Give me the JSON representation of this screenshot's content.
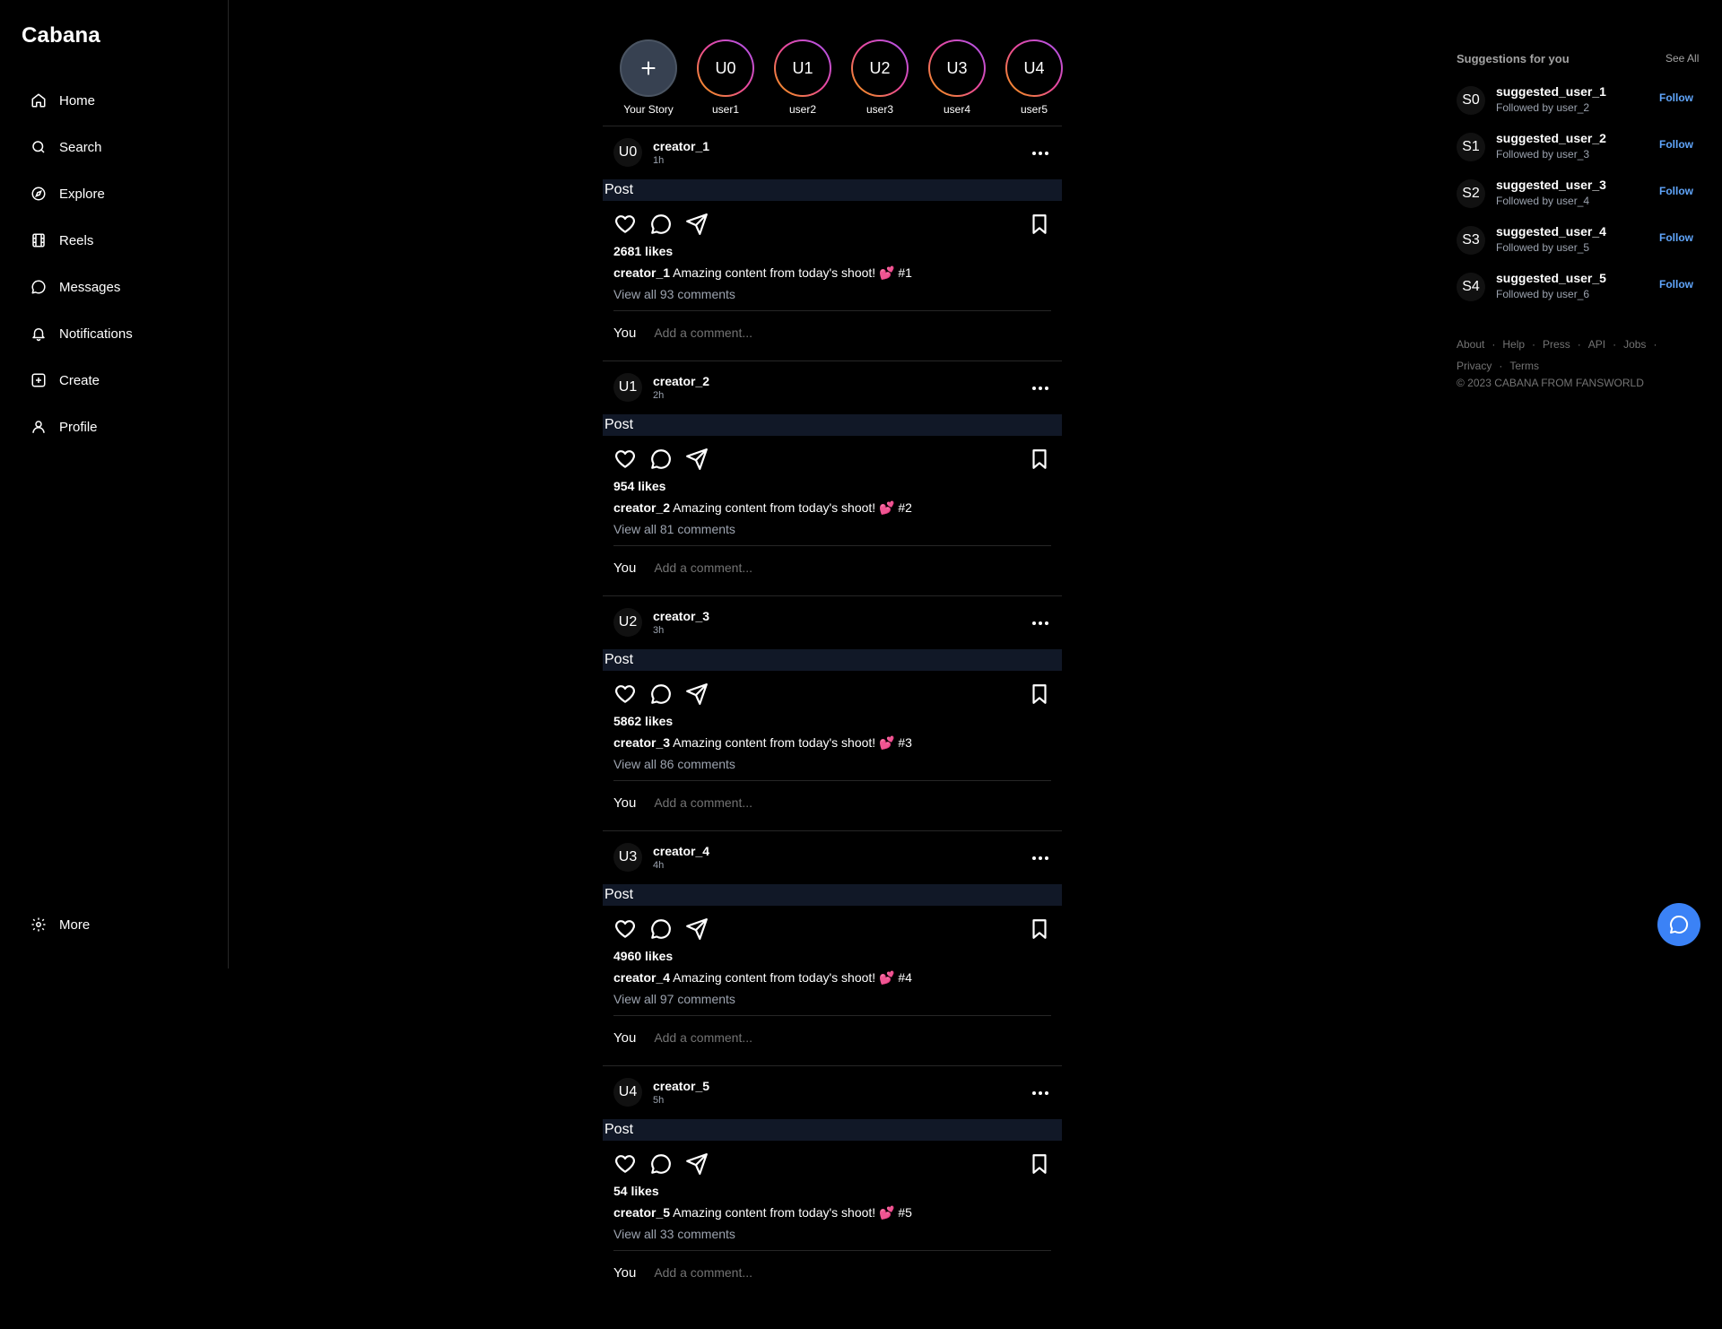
{
  "app": {
    "logo": "Cabana"
  },
  "sidebar": {
    "items": [
      {
        "label": "Home",
        "icon": "home-icon"
      },
      {
        "label": "Search",
        "icon": "search-icon"
      },
      {
        "label": "Explore",
        "icon": "compass-icon"
      },
      {
        "label": "Reels",
        "icon": "film-icon"
      },
      {
        "label": "Messages",
        "icon": "message-icon"
      },
      {
        "label": "Notifications",
        "icon": "bell-icon"
      },
      {
        "label": "Create",
        "icon": "plus-square-icon"
      },
      {
        "label": "Profile",
        "icon": "user-icon"
      }
    ],
    "more": {
      "label": "More",
      "icon": "gear-icon"
    }
  },
  "stories": {
    "your_story": {
      "label": "Your Story",
      "icon": "plus-icon"
    },
    "items": [
      {
        "initials": "U0",
        "label": "user1"
      },
      {
        "initials": "U1",
        "label": "user2"
      },
      {
        "initials": "U2",
        "label": "user3"
      },
      {
        "initials": "U3",
        "label": "user4"
      },
      {
        "initials": "U4",
        "label": "user5"
      }
    ]
  },
  "posts": [
    {
      "initials": "U0",
      "user": "creator_1",
      "time": "1h",
      "image_alt": "Post",
      "likes": "2681 likes",
      "caption_user": "creator_1",
      "caption_text": "Amazing content from today's shoot! 💕 #1",
      "comments": "View all 93 comments"
    },
    {
      "initials": "U1",
      "user": "creator_2",
      "time": "2h",
      "image_alt": "Post",
      "likes": "954 likes",
      "caption_user": "creator_2",
      "caption_text": "Amazing content from today's shoot! 💕 #2",
      "comments": "View all 81 comments"
    },
    {
      "initials": "U2",
      "user": "creator_3",
      "time": "3h",
      "image_alt": "Post",
      "likes": "5862 likes",
      "caption_user": "creator_3",
      "caption_text": "Amazing content from today's shoot! 💕 #3",
      "comments": "View all 86 comments"
    },
    {
      "initials": "U3",
      "user": "creator_4",
      "time": "4h",
      "image_alt": "Post",
      "likes": "4960 likes",
      "caption_user": "creator_4",
      "caption_text": "Amazing content from today's shoot! 💕 #4",
      "comments": "View all 97 comments"
    },
    {
      "initials": "U4",
      "user": "creator_5",
      "time": "5h",
      "image_alt": "Post",
      "likes": "54 likes",
      "caption_user": "creator_5",
      "caption_text": "Amazing content from today's shoot! 💕 #5",
      "comments": "View all 33 comments"
    }
  ],
  "comment_box": {
    "you_label": "You",
    "placeholder": "Add a comment..."
  },
  "suggestions": {
    "title": "Suggestions for you",
    "see_all": "See All",
    "follow_label": "Follow",
    "items": [
      {
        "initials": "S0",
        "name": "suggested_user_1",
        "sub": "Followed by user_2"
      },
      {
        "initials": "S1",
        "name": "suggested_user_2",
        "sub": "Followed by user_3"
      },
      {
        "initials": "S2",
        "name": "suggested_user_3",
        "sub": "Followed by user_4"
      },
      {
        "initials": "S3",
        "name": "suggested_user_4",
        "sub": "Followed by user_5"
      },
      {
        "initials": "S4",
        "name": "suggested_user_5",
        "sub": "Followed by user_6"
      }
    ]
  },
  "footer": {
    "links": [
      "About",
      "Help",
      "Press",
      "API",
      "Jobs",
      "Privacy",
      "Terms"
    ],
    "copyright": "© 2023 CABANA FROM FANSWORLD"
  },
  "colors": {
    "accent": "#3b82f6",
    "follow": "#60a5fa",
    "story_ring": "#ec4899"
  },
  "chat_fab": {
    "icon": "chat-bubble-icon"
  }
}
